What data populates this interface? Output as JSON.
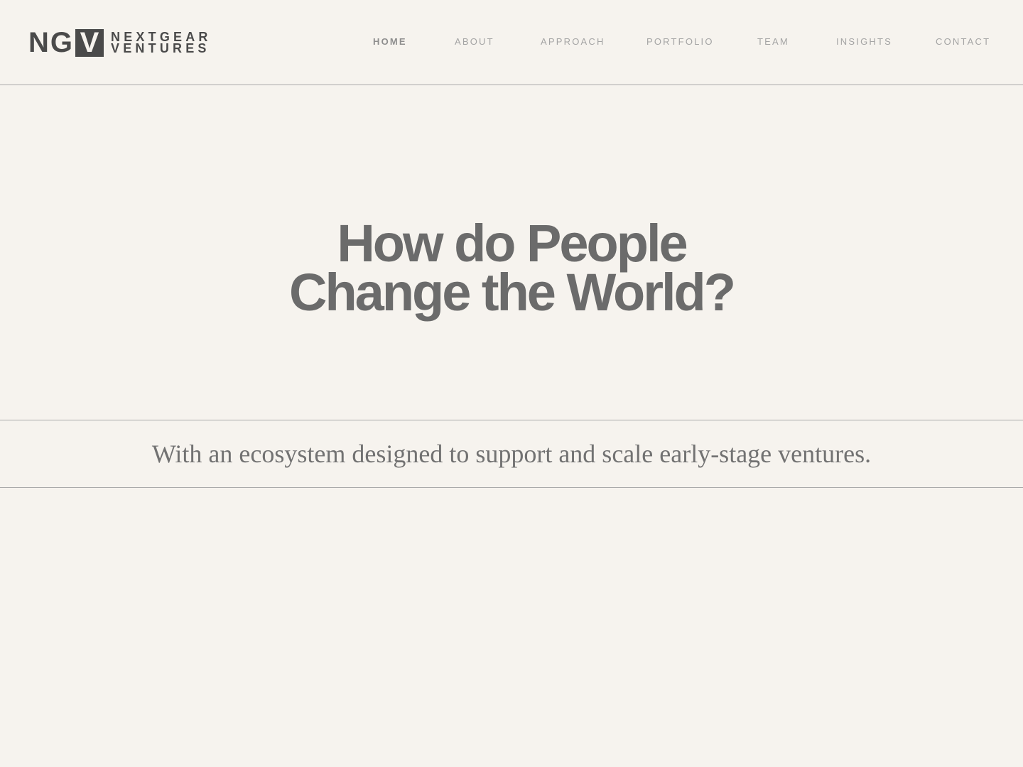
{
  "brand": {
    "mark_letters": [
      "N",
      "G"
    ],
    "mark_box_letter": "V",
    "name_line1": "NEXTGEAR",
    "name_line2": "VENTURES"
  },
  "nav": {
    "items": [
      {
        "label": "HOME",
        "active": true
      },
      {
        "label": "ABOUT",
        "active": false
      },
      {
        "label": "APPROACH",
        "active": false
      },
      {
        "label": "PORTFOLIO",
        "active": false
      },
      {
        "label": "TEAM",
        "active": false
      },
      {
        "label": "INSIGHTS",
        "active": false
      },
      {
        "label": "CONTACT",
        "active": false
      }
    ]
  },
  "hero": {
    "title_line1": "How do People",
    "title_line2": "Change the World?"
  },
  "tagline": {
    "text": "With an ecosystem designed to support and scale early-stage ventures."
  },
  "colors": {
    "background": "#f6f3ee",
    "logo": "#4a4a4a",
    "heading": "#6b6b6b",
    "nav_text": "#a4a4a4",
    "rule": "#a9a9a9"
  }
}
